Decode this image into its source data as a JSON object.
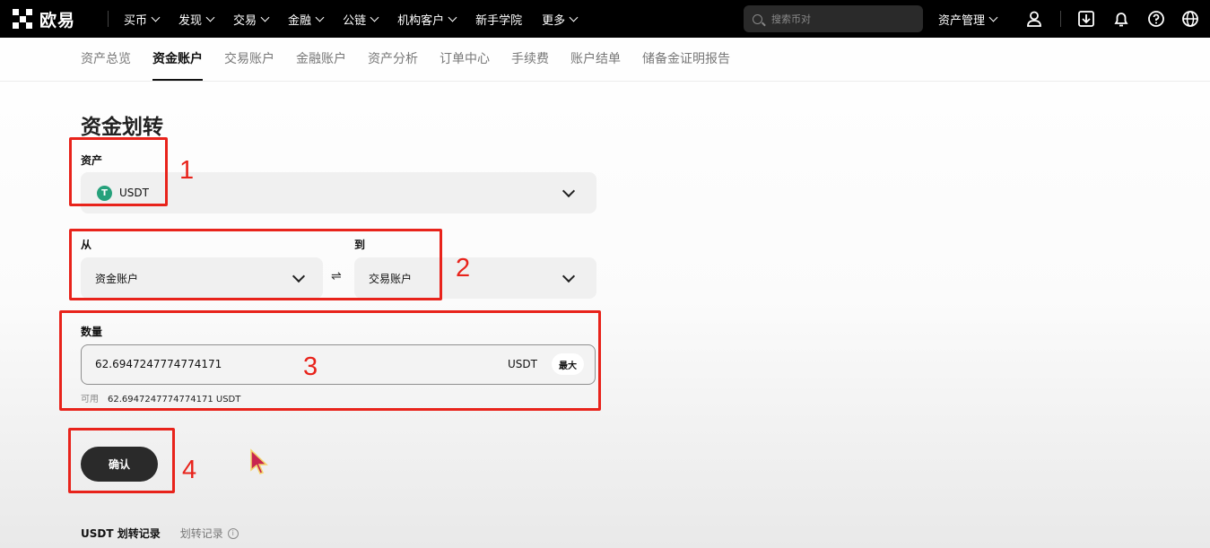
{
  "topbar": {
    "brand": "欧易",
    "nav": [
      {
        "label": "买币",
        "dropdown": true
      },
      {
        "label": "发现",
        "dropdown": true
      },
      {
        "label": "交易",
        "dropdown": true
      },
      {
        "label": "金融",
        "dropdown": true
      },
      {
        "label": "公链",
        "dropdown": true
      },
      {
        "label": "机构客户",
        "dropdown": true
      },
      {
        "label": "新手学院",
        "dropdown": false
      },
      {
        "label": "更多",
        "dropdown": true
      }
    ],
    "search_placeholder": "搜索币对",
    "asset_management": "资产管理",
    "icons": [
      "user-icon",
      "download-icon",
      "bell-icon",
      "help-icon",
      "globe-icon"
    ]
  },
  "subtabs": [
    {
      "label": "资产总览",
      "active": false
    },
    {
      "label": "资金账户",
      "active": true
    },
    {
      "label": "交易账户",
      "active": false
    },
    {
      "label": "金融账户",
      "active": false
    },
    {
      "label": "资产分析",
      "active": false
    },
    {
      "label": "订单中心",
      "active": false
    },
    {
      "label": "手续费",
      "active": false
    },
    {
      "label": "账户结单",
      "active": false
    },
    {
      "label": "储备金证明报告",
      "active": false
    }
  ],
  "form": {
    "title": "资金划转",
    "asset_label": "资产",
    "asset_value": "USDT",
    "asset_coin_glyph": "T",
    "from_label": "从",
    "from_value": "资金账户",
    "to_label": "到",
    "to_value": "交易账户",
    "swap_glyph": "⇌",
    "amount_label": "数量",
    "amount_value": "62.6947247774774171",
    "amount_unit": "USDT",
    "max_label": "最大",
    "available_label": "可用",
    "available_value": "62.6947247774774171 USDT",
    "confirm_label": "确认"
  },
  "records": {
    "tab1": "USDT 划转记录",
    "tab2": "划转记录"
  },
  "annotations": [
    "1",
    "2",
    "3",
    "4"
  ],
  "colors": {
    "annotation": "#e8231b",
    "usdt": "#26a17b",
    "topbar": "#000000"
  }
}
